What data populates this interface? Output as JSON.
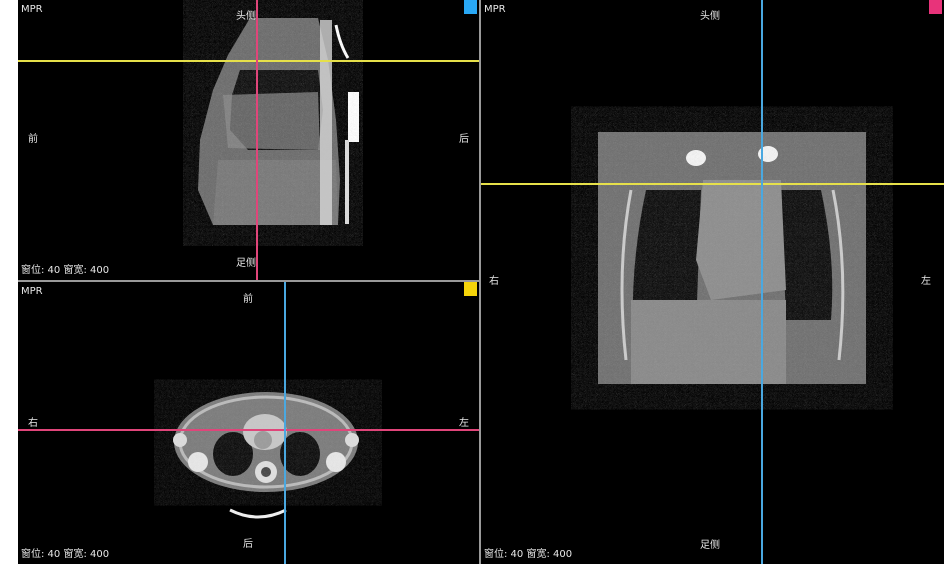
{
  "viewports": {
    "sagittal": {
      "title": "MPR",
      "orientation": {
        "top": "头侧",
        "bottom": "足侧",
        "left": "前",
        "right": "后"
      },
      "window_level": "窗位: 40 窗宽: 400",
      "marker_color": "#29a8f5",
      "crosshair": {
        "horizontal_color": "#e6e04a",
        "vertical_color": "#e0457a"
      }
    },
    "axial": {
      "title": "MPR",
      "orientation": {
        "top": "前",
        "bottom": "后",
        "left": "右",
        "right": "左"
      },
      "window_level": "窗位: 40 窗宽: 400",
      "marker_color": "#f5d40a",
      "crosshair": {
        "horizontal_color": "#e0457a",
        "vertical_color": "#4aa8e0"
      }
    },
    "coronal": {
      "title": "MPR",
      "orientation": {
        "top": "头侧",
        "bottom": "足侧",
        "left": "右",
        "right": "左"
      },
      "window_level": "窗位: 40 窗宽: 400",
      "marker_color": "#e8337a",
      "crosshair": {
        "horizontal_color": "#e6e04a",
        "vertical_color": "#4aa8e0"
      }
    }
  }
}
